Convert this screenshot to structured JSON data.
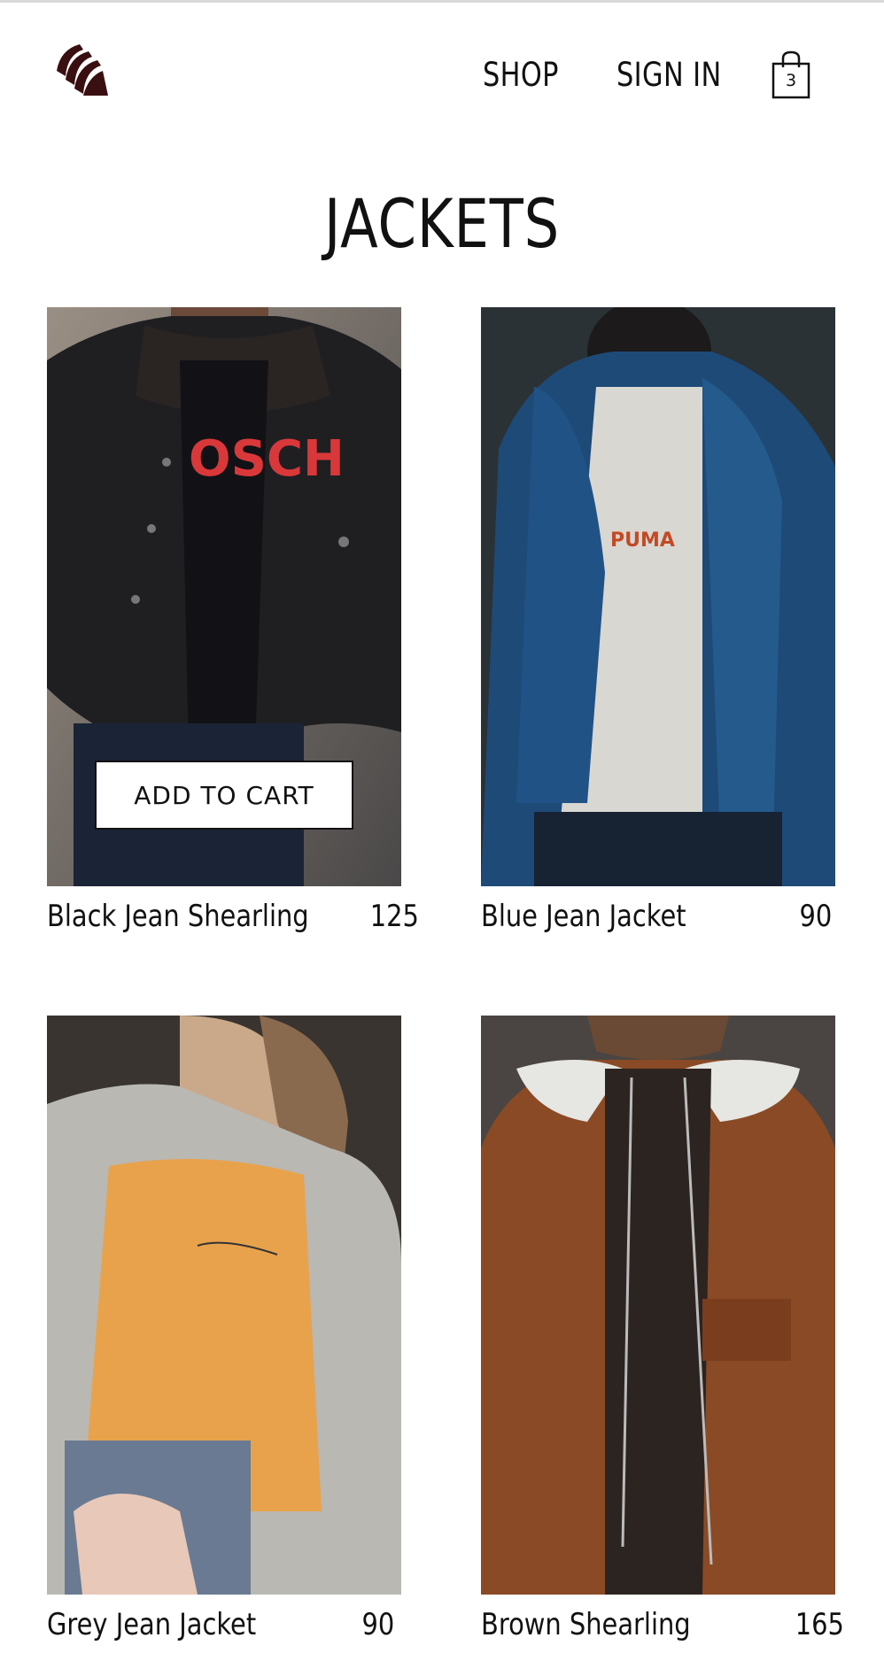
{
  "header": {
    "logo_icon": "striped-claw-logo",
    "nav": {
      "shop": "SHOP",
      "sign_in": "SIGN IN"
    },
    "cart": {
      "icon": "shopping-bag-icon",
      "count": "3"
    }
  },
  "page": {
    "title": "JACKETS"
  },
  "products": [
    {
      "name": "Black Jean Shearling",
      "price": "125",
      "add_to_cart": "ADD TO CART"
    },
    {
      "name": "Blue Jean Jacket",
      "price": "90"
    },
    {
      "name": "Grey Jean Jacket",
      "price": "90"
    },
    {
      "name": "Brown Shearling",
      "price": "165"
    }
  ],
  "colors": {
    "logo": "#3a0f12",
    "text": "#111111",
    "divider": "#d9d9d9"
  }
}
